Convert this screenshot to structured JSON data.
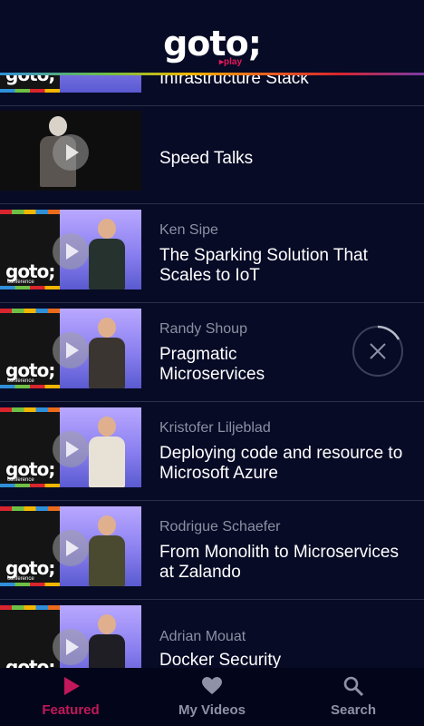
{
  "header": {
    "logo": "goto;",
    "logo_sub": "play"
  },
  "items": [
    {
      "speaker": "",
      "title": "Infrastructure Stack"
    },
    {
      "speaker": "",
      "title": "Speed Talks"
    },
    {
      "speaker": "Ken Sipe",
      "title": "The Sparking Solution That Scales to IoT"
    },
    {
      "speaker": "Randy Shoup",
      "title": "Pragmatic Microservices"
    },
    {
      "speaker": "Kristofer Liljeblad",
      "title": "Deploying code and resource to Microsoft Azure"
    },
    {
      "speaker": "Rodrigue Schaefer",
      "title": "From Monolith to Microservices at Zalando"
    },
    {
      "speaker": "Adrian Mouat",
      "title": "Docker Security"
    }
  ],
  "thumb_logo": "goto;",
  "thumb_logo_sub": "conference",
  "nav": {
    "featured": "Featured",
    "my_videos": "My Videos",
    "search": "Search"
  },
  "colors": {
    "accent": "#c2185b",
    "background": "#070b26"
  }
}
